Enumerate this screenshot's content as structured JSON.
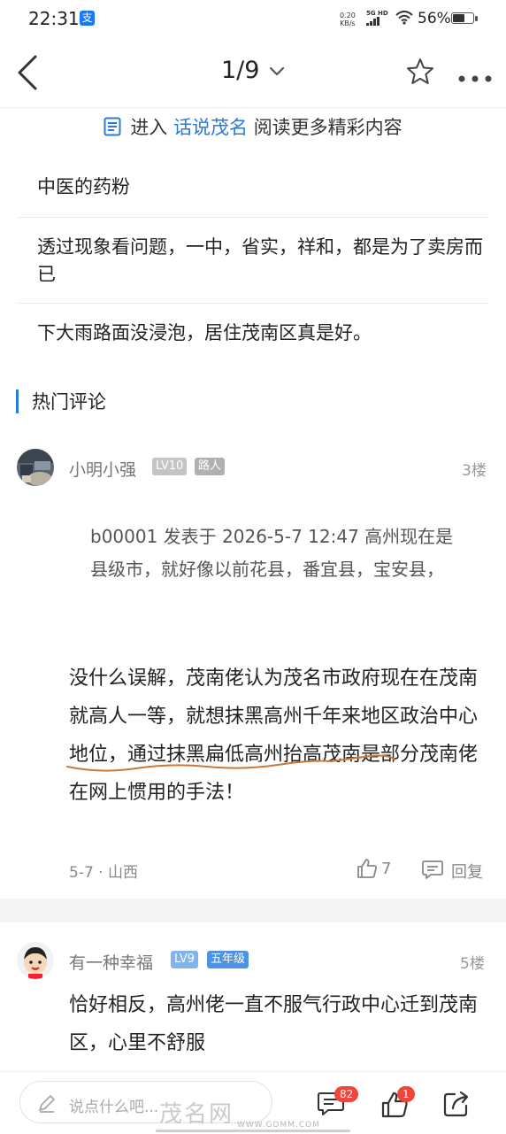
{
  "status_bar": {
    "time": "22:31",
    "alipay_glyph": "支",
    "speed_value": "0.20",
    "speed_unit": "KB/s",
    "network": "5G HD",
    "battery": "56%"
  },
  "nav": {
    "pager": "1/9"
  },
  "enter_banner": {
    "prefix": "进入",
    "forum": "话说茂名",
    "suffix": "阅读更多精彩内容"
  },
  "replies": [
    "中医的药粉",
    "透过现象看问题，一中，省实，祥和，都是为了卖房而已",
    "下大雨路面没浸泡，居住茂南区真是好。"
  ],
  "hot_comments_title": "热门评论",
  "comments": [
    {
      "user": "小明小强",
      "level": "LV10",
      "rank": "路人",
      "floor": "3楼",
      "quote": "b00001 发表于 2026-5-7 12:47 高州现在是县级市，就好像以前花县，番宜县，宝安县，",
      "content": "没什么误解，茂南佬认为茂名市政府现在在茂南就高人一等，就想抹黑高州千年来地区政治中心地位，通过抹黑扁低高州抬高茂南是部分茂南佬在网上惯用的手法！",
      "date_location": "5-7 · 山西",
      "likes": "7",
      "reply_label": "回复"
    },
    {
      "user": "有一种幸福",
      "level": "LV9",
      "rank": "五年级",
      "floor": "5楼",
      "content": "恰好相反，高州佬一直不服气行政中心迁到茂南区，心里不舒服"
    }
  ],
  "bottom_bar": {
    "placeholder": "说点什么吧...",
    "message_count": "82",
    "like_count": "1"
  },
  "watermark": {
    "main": "茂名网",
    "sub": "WWW.GDMM.COM"
  },
  "colors": {
    "accent": "#2a7bd8",
    "badge_red": "#f0453d",
    "level_grey": "#c4c4c4",
    "rank_grey": "#b0b0b0",
    "level_blue": "#7fb4ee",
    "rank_blue": "#4f92e3"
  }
}
